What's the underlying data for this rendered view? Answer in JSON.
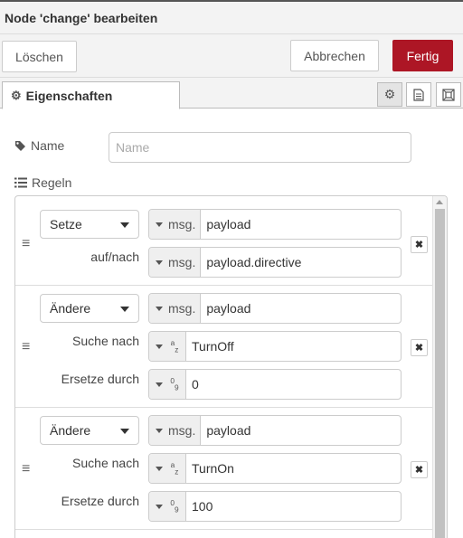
{
  "dialog": {
    "title": "Node 'change' bearbeiten"
  },
  "toolbar": {
    "delete_label": "Löschen",
    "cancel_label": "Abbrechen",
    "done_label": "Fertig"
  },
  "tabs": {
    "properties_label": "Eigenschaften",
    "icons": [
      "gear-icon",
      "description-icon",
      "appearance-icon"
    ]
  },
  "form": {
    "name_label": "Name",
    "name_placeholder": "Name",
    "name_value": "",
    "rules_label": "Regeln"
  },
  "rules": [
    {
      "action": "Setze",
      "target_type": "msg.",
      "target_value": "payload",
      "to_label": "auf/nach",
      "to_type": "msg.",
      "to_value": "payload.directive"
    },
    {
      "action": "Ändere",
      "target_type": "msg.",
      "target_value": "payload",
      "search_label": "Suche nach",
      "search_type": "a-z",
      "search_value": "TurnOff",
      "replace_label": "Ersetze durch",
      "replace_type": "0-9",
      "replace_value": "0"
    },
    {
      "action": "Ändere",
      "target_type": "msg.",
      "target_value": "payload",
      "search_label": "Suche nach",
      "search_type": "a-z",
      "search_value": "TurnOn",
      "replace_label": "Ersetze durch",
      "replace_type": "0-9",
      "replace_value": "100"
    }
  ],
  "colors": {
    "accent": "#ad1625",
    "border": "#cccccc",
    "panel": "#f3f3f3"
  }
}
